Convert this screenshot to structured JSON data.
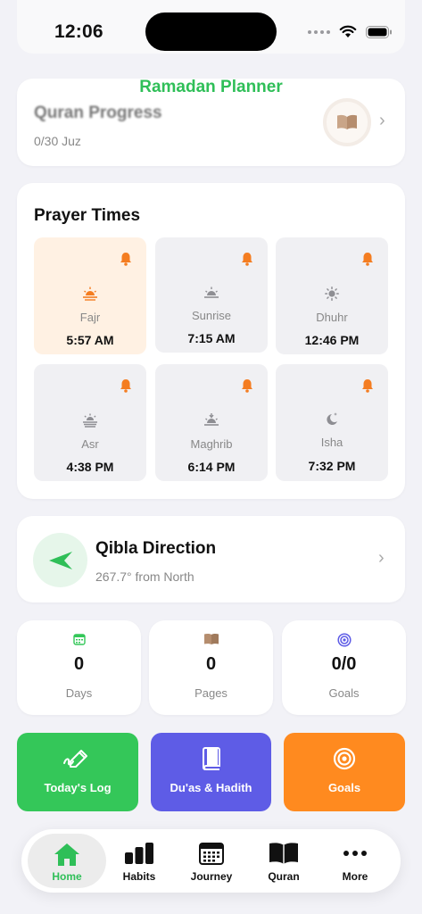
{
  "status_bar": {
    "time": "12:06"
  },
  "app_title": "Ramadan Planner",
  "quran_progress": {
    "title": "Quran Progress",
    "subtitle": "0/30 Juz",
    "progress": 0
  },
  "prayer_times": {
    "heading": "Prayer Times",
    "items": [
      {
        "name": "Fajr",
        "time": "5:57 AM",
        "icon": "sunrise-icon",
        "active": true
      },
      {
        "name": "Sunrise",
        "time": "7:15 AM",
        "icon": "sunrise-icon"
      },
      {
        "name": "Dhuhr",
        "time": "12:46 PM",
        "icon": "sun-icon"
      },
      {
        "name": "Asr",
        "time": "4:38 PM",
        "icon": "sun-haze-icon"
      },
      {
        "name": "Maghrib",
        "time": "6:14 PM",
        "icon": "sunset-icon"
      },
      {
        "name": "Isha",
        "time": "7:32 PM",
        "icon": "moon-stars-icon"
      }
    ]
  },
  "qibla": {
    "title": "Qibla Direction",
    "subtitle": "267.7° from North"
  },
  "stats": [
    {
      "value": "0",
      "label": "Days",
      "icon": "calendar-icon"
    },
    {
      "value": "0",
      "label": "Pages",
      "icon": "book-icon"
    },
    {
      "value": "0/0",
      "label": "Goals",
      "icon": "target-icon"
    }
  ],
  "actions": [
    {
      "label": "Today's Log",
      "icon": "pencil-icon",
      "color": "#34c759"
    },
    {
      "label": "Du'as & Hadith",
      "icon": "book-closed-icon",
      "color": "#5e5ce6"
    },
    {
      "label": "Goals",
      "icon": "target-icon",
      "color": "#ff8a1f"
    }
  ],
  "tabs": [
    {
      "label": "Home",
      "icon": "house-icon",
      "active": true
    },
    {
      "label": "Habits",
      "icon": "chart-bars-icon"
    },
    {
      "label": "Journey",
      "icon": "calendar-grid-icon"
    },
    {
      "label": "Quran",
      "icon": "open-book-icon"
    },
    {
      "label": "More",
      "icon": "ellipsis-icon"
    }
  ],
  "colors": {
    "accent_green": "#2fbf58",
    "accent_orange": "#ff8a1f",
    "accent_purple": "#5e5ce6",
    "background": "#f2f2f7"
  }
}
